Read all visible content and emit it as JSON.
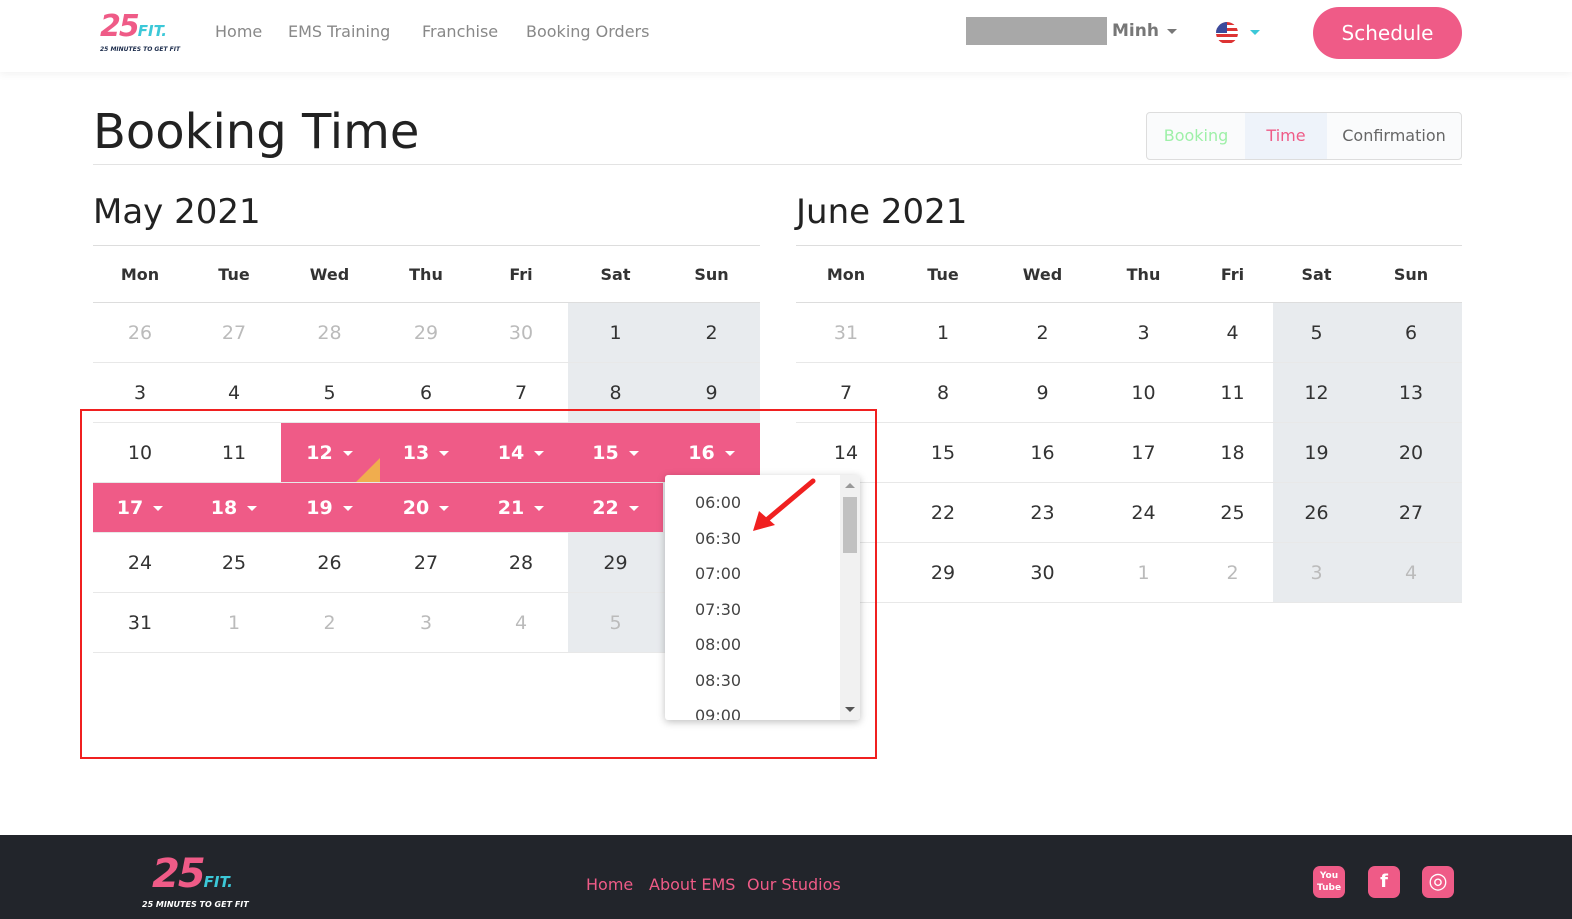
{
  "header": {
    "logo_text": "25",
    "logo_fit": "FIT.",
    "logo_tagline": "25 MINUTES TO GET FIT",
    "nav": [
      "Home",
      "EMS Training",
      "Franchise",
      "Booking Orders"
    ],
    "user": "Minh",
    "language_icon": "us-flag-icon",
    "schedule_label": "Schedule"
  },
  "page": {
    "title": "Booking Time",
    "steps": [
      {
        "label": "Booking",
        "color": "#9ef0a8"
      },
      {
        "label": "Time",
        "color": "#ef5b87"
      },
      {
        "label": "Confirmation",
        "color": "#666666"
      }
    ]
  },
  "colors": {
    "accent": "#ef5b87",
    "weekend": "#e8ebee",
    "annotation": "#f02020"
  },
  "weekdays": [
    "Mon",
    "Tue",
    "Wed",
    "Thu",
    "Fri",
    "Sat",
    "Sun"
  ],
  "calendars": [
    {
      "title": "May 2021",
      "rows": [
        [
          "26",
          "27",
          "28",
          "29",
          "30",
          "1",
          "2"
        ],
        [
          "3",
          "4",
          "5",
          "6",
          "7",
          "8",
          "9"
        ],
        [
          "10",
          "11",
          "12",
          "13",
          "14",
          "15",
          "16"
        ],
        [
          "17",
          "18",
          "19",
          "20",
          "21",
          "22",
          ""
        ],
        [
          "24",
          "25",
          "26",
          "27",
          "28",
          "29",
          ""
        ],
        [
          "31",
          "1",
          "2",
          "3",
          "4",
          "5",
          ""
        ]
      ],
      "outside": [
        [
          0,
          0
        ],
        [
          0,
          1
        ],
        [
          0,
          2
        ],
        [
          0,
          3
        ],
        [
          0,
          4
        ],
        [
          5,
          1
        ],
        [
          5,
          2
        ],
        [
          5,
          3
        ],
        [
          5,
          4
        ],
        [
          5,
          5
        ]
      ],
      "selected": [
        "12",
        "13",
        "14",
        "15",
        "16",
        "17",
        "18",
        "19",
        "20",
        "21",
        "22"
      ]
    },
    {
      "title": "June 2021",
      "rows": [
        [
          "31",
          "1",
          "2",
          "3",
          "4",
          "5",
          "6"
        ],
        [
          "7",
          "8",
          "9",
          "10",
          "11",
          "12",
          "13"
        ],
        [
          "14",
          "15",
          "16",
          "17",
          "18",
          "19",
          "20"
        ],
        [
          "",
          "22",
          "23",
          "24",
          "25",
          "26",
          "27"
        ],
        [
          "",
          "29",
          "30",
          "1",
          "2",
          "3",
          "4"
        ]
      ],
      "outside": [
        [
          0,
          0
        ],
        [
          4,
          3
        ],
        [
          4,
          4
        ],
        [
          4,
          5
        ],
        [
          4,
          6
        ]
      ],
      "selected": []
    }
  ],
  "time_dropdown": {
    "options": [
      "06:00",
      "06:30",
      "07:00",
      "07:30",
      "08:00",
      "08:30",
      "09:00"
    ]
  },
  "footer": {
    "links": [
      "Home",
      "About EMS",
      "Our Studios"
    ],
    "social": [
      "youtube-icon",
      "facebook-icon",
      "instagram-icon"
    ],
    "youtube_text": "You Tube",
    "facebook_text": "f",
    "instagram_text": "◎"
  }
}
